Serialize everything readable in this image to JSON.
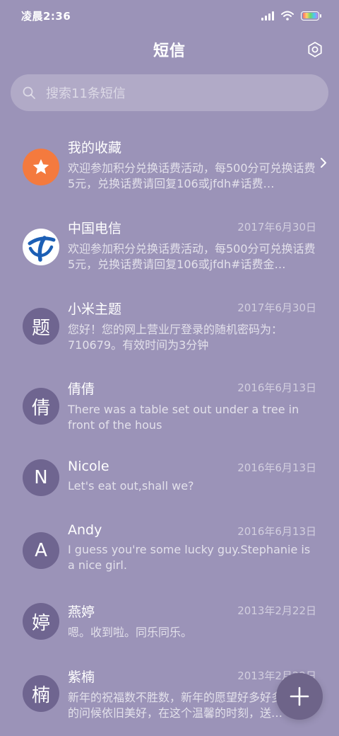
{
  "status_bar": {
    "time": "凌晨2:36"
  },
  "header": {
    "title": "短信"
  },
  "search": {
    "placeholder": "搜索11条短信"
  },
  "icons": {
    "settings": "gear-icon",
    "search": "search-icon",
    "star": "star-icon",
    "telecom": "china-telecom-logo-icon",
    "chevron": "chevron-right-icon",
    "compose": "plus-icon"
  },
  "colors": {
    "background": "#9b93b8",
    "avatar": "#6f6590",
    "favorites_avatar": "#f47a3e",
    "fab": "#6e6489",
    "telecom_blue": "#1c5fb5"
  },
  "conversations": [
    {
      "name": "我的收藏",
      "date": "",
      "preview": "欢迎参加积分兑换话费活动，每500分可兑换话费5元，兑换话费请回复106或jfdh#话费…",
      "avatar_text": ""
    },
    {
      "name": "中国电信",
      "date": "2017年6月30日",
      "preview": "欢迎参加积分兑换话费活动，每500分可兑换话费5元，兑换话费请回复106或jfdh#话费金…",
      "avatar_text": ""
    },
    {
      "name": "小米主题",
      "date": "2017年6月30日",
      "preview": "您好！您的网上营业厅登录的随机密码为：710679。有效时间为3分钟",
      "avatar_text": "题"
    },
    {
      "name": "倩倩",
      "date": "2016年6月13日",
      "preview": "There was a table set out under a tree in front of the hous",
      "avatar_text": "倩"
    },
    {
      "name": "Nicole",
      "date": "2016年6月13日",
      "preview": "Let's eat out,shall we?",
      "avatar_text": "N"
    },
    {
      "name": "Andy",
      "date": "2016年6月13日",
      "preview": "I guess you're some lucky guy.Stephanie is a nice girl.",
      "avatar_text": "A"
    },
    {
      "name": "燕婷",
      "date": "2013年2月22日",
      "preview": "嗯。收到啦。同乐同乐。",
      "avatar_text": "婷"
    },
    {
      "name": "紫楠",
      "date": "2013年2月22日",
      "preview": "新年的祝福数不胜数，新年的愿望好多好多，新年的问候依旧美好，在这个温馨的时刻，送…",
      "avatar_text": "楠"
    }
  ]
}
